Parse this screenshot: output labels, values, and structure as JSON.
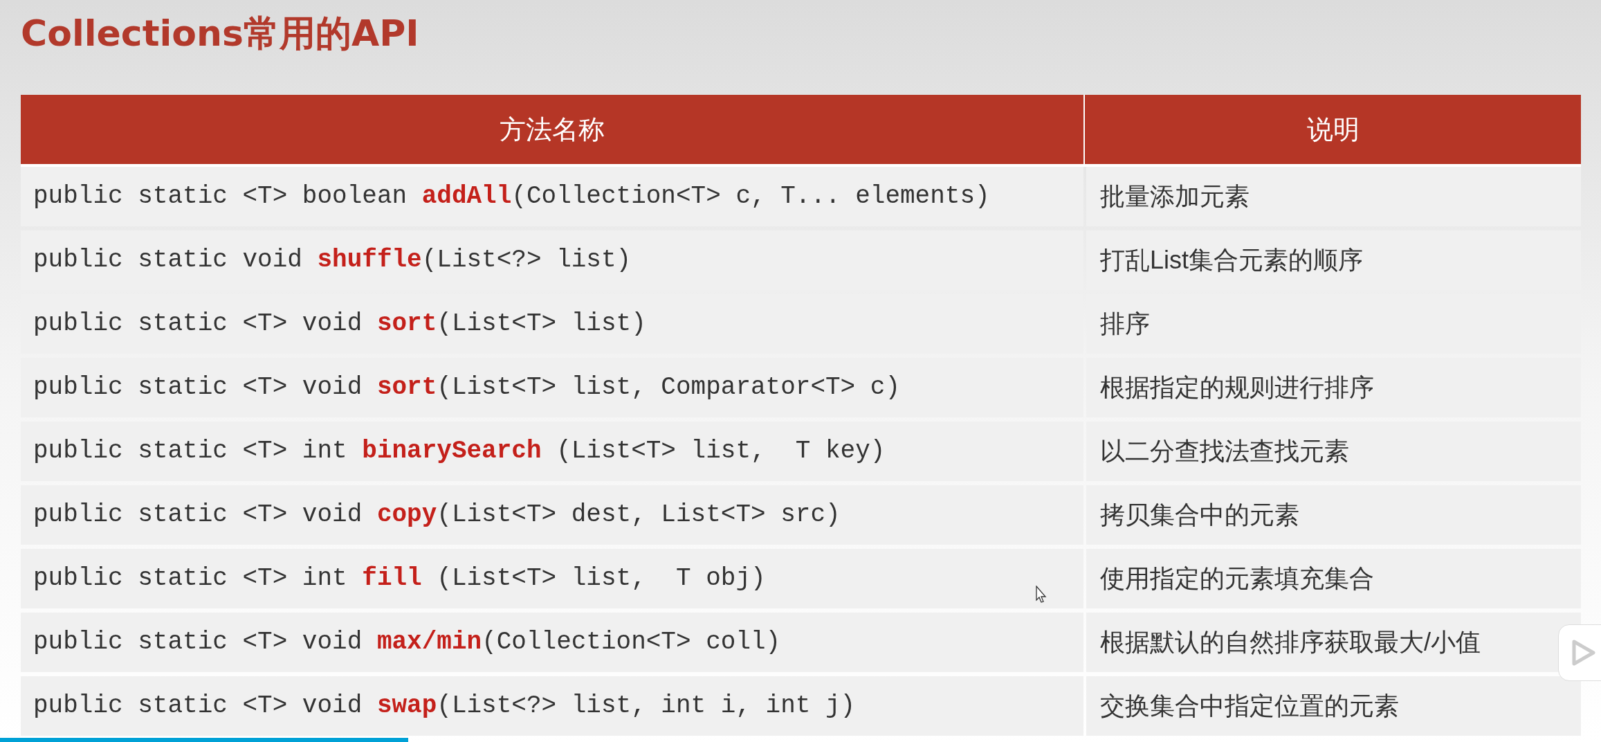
{
  "title": "Collections常用的API",
  "table": {
    "columns": [
      "方法名称",
      "说明"
    ],
    "rows": [
      {
        "method": "public static <T> boolean **addAll**(Collection<T> c, T... elements)",
        "description": "批量添加元素"
      },
      {
        "method": "public static void **shuffle**(List<?> list)",
        "description": "打乱List集合元素的顺序"
      },
      {
        "method": "public static <T> void **sort**(List<T> list)",
        "description": "排序"
      },
      {
        "method": "public static <T> void **sort**(List<T> list, Comparator<T> c)",
        "description": "根据指定的规则进行排序"
      },
      {
        "method": "public static <T> int **binarySearch** (List<T> list,  T key)",
        "description": "以二分查找法查找元素"
      },
      {
        "method": "public static <T> void **copy**(List<T> dest, List<T> src)",
        "description": "拷贝集合中的元素"
      },
      {
        "method": "public static <T> int **fill** (List<T> list,  T obj)",
        "description": "使用指定的元素填充集合"
      },
      {
        "method": "public static <T> void **max/min**(Collection<T> coll)",
        "description": "根据默认的自然排序获取最大/小值"
      },
      {
        "method": "public static <T> void **swap**(List<?> list, int i, int j)",
        "description": "交换集合中指定位置的元素"
      }
    ]
  },
  "player": {
    "progress": {
      "level": 0.255
    }
  }
}
